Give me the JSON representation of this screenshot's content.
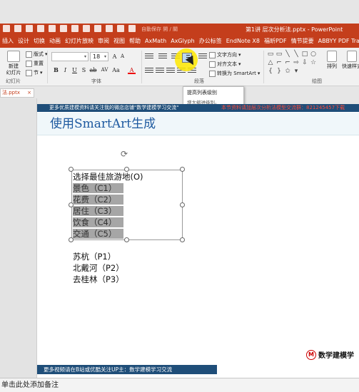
{
  "window": {
    "autosave_label": "自動保存 開 / 關",
    "title": "第1讲 层次分析法.pptx - PowerPoint"
  },
  "tabs": [
    "插入",
    "设计",
    "切换",
    "动画",
    "幻灯片放映",
    "审阅",
    "视图",
    "帮助",
    "AxMath",
    "AxGlyph",
    "办公标签",
    "EndNote X8",
    "福昕PDF",
    "情节提要",
    "ABBYY PDF Transformer+"
  ],
  "ribbon": {
    "new_slide": "新建\n幻灯片",
    "layout": "版式",
    "reset": "重置",
    "section": "节",
    "slides_group": "幻灯片",
    "font_group": "字体",
    "paragraph_group": "段落",
    "drawing_group": "绘图",
    "font_size": "18",
    "text_direction": "文字方向",
    "align_text": "对齐文本",
    "convert_smartart": "转换为 SmartArt",
    "arrange": "排列",
    "quick_styles": "快速样式",
    "bold": "B",
    "italic": "I",
    "underline": "U",
    "strike": "S",
    "font_color_glyph": "A"
  },
  "tooltip": {
    "title": "提高列表级别",
    "desc": "增大缩进级别。"
  },
  "file_tab": {
    "name": "法.pptx",
    "close": "×"
  },
  "slide": {
    "top_banner": "更多优质建模资料请关注我的微店店铺\"数学建模学习交流\"",
    "top_banner_right": "本节资料请加层次分析法模型交流群：821245457下载",
    "title": "使用SmartArt生成",
    "lines": [
      "选择最佳旅游地(O)",
      "景色（C1）",
      "花费（C2）",
      "居住（C3）",
      "饮食（C4）",
      "交通（C5）"
    ],
    "lines2": [
      "苏杭（P1）",
      "北戴河（P2）",
      "去桂林（P3）"
    ],
    "logo_letter": "M",
    "logo_text": "数学建模学",
    "bottom_banner": "更多视频请在B站或优酷关注UP主：数学建模学习交流"
  },
  "notes_placeholder": "单击此处添加备注",
  "colors": {
    "accent": "#c43e1c",
    "banner": "#1f4e79",
    "title_text": "#1e5aa0"
  }
}
